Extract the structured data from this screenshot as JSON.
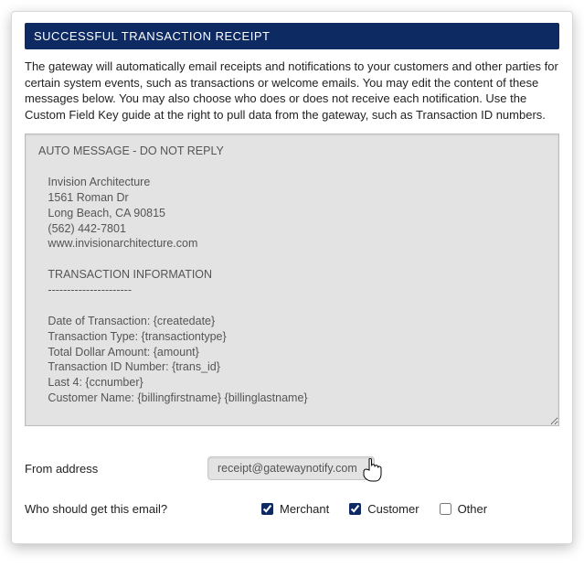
{
  "header": {
    "title": "SUCCESSFUL TRANSACTION RECEIPT"
  },
  "description": "The gateway will automatically email receipts and notifications to your customers and other parties for certain system events, such as transactions or welcome emails. You may edit the content of these messages below. You may also choose who does or does not receive each notification. Use the Custom Field Key guide at the right to pull data from the gateway, such as Transaction ID numbers.",
  "message_body": "AUTO MESSAGE - DO NOT REPLY\n\n   Invision Architecture\n   1561 Roman Dr\n   Long Beach, CA 90815\n   (562) 442-7801\n   www.invisionarchitecture.com\n\n   TRANSACTION INFORMATION\n   ----------------------\n\n   Date of Transaction: {createdate}\n   Transaction Type: {transactiontype}\n   Total Dollar Amount: {amount}\n   Transaction ID Number: {trans_id}\n   Last 4: {ccnumber}\n   Customer Name: {billingfirstname} {billinglastname}",
  "from": {
    "label": "From address",
    "value": "receipt@gatewaynotify.com"
  },
  "recipients": {
    "label": "Who should get this email?",
    "options": {
      "merchant": "Merchant",
      "customer": "Customer",
      "other": "Other"
    },
    "checked": {
      "merchant": true,
      "customer": true,
      "other": false
    }
  }
}
